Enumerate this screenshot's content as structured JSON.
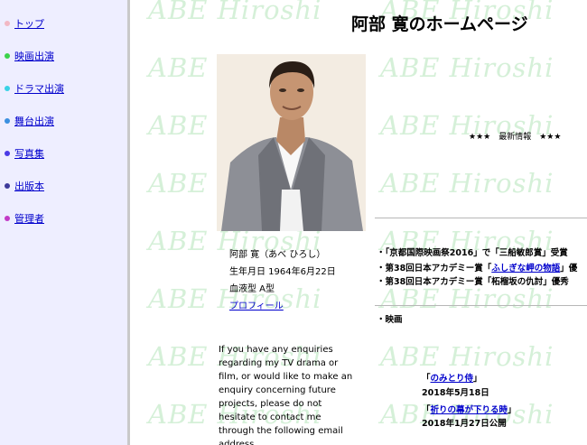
{
  "nav": {
    "items": [
      {
        "label": "トップ",
        "color": "#f2b8c4"
      },
      {
        "label": "映画出演",
        "color": "#3bd24a"
      },
      {
        "label": "ドラマ出演",
        "color": "#39d2e6"
      },
      {
        "label": "舞台出演",
        "color": "#3a8fe0"
      },
      {
        "label": "写真集",
        "color": "#4a3ae6"
      },
      {
        "label": "出版本",
        "color": "#3d3a9a"
      },
      {
        "label": "管理者",
        "color": "#c23ac6"
      }
    ]
  },
  "watermark_text": "ABE Hiroshi",
  "page_title": "阿部 寛のホームページ",
  "news_heading": "★★★　最新情報　★★★",
  "profile": {
    "name": "阿部 寛（あべ ひろし）",
    "birthday": "生年月日 1964年6月22日",
    "blood_type": "血液型 A型",
    "link": "プロフィール"
  },
  "contact_text": "If you have any enquiries regarding my TV drama or film, or would like to make an enquiry concerning future projects, please do not hesitate to contact me through the following email address.",
  "news": [
    {
      "pre": "・「京都国際映画祭2016」で「三船敏郎賞」受賞",
      "link": "",
      "post": ""
    },
    {
      "pre": "・第38回日本アカデミー賞「",
      "link": "ふしぎな岬の物語",
      "post": "」優"
    },
    {
      "pre": "・第38回日本アカデミー賞「柘榴坂の仇討」優秀",
      "link": "",
      "post": ""
    }
  ],
  "movies_label": "・映画",
  "movies": [
    {
      "title": "のみとり侍",
      "date": "2018年5月18日"
    },
    {
      "title": "祈りの幕が下りる時",
      "date": "2018年1月27日公開"
    }
  ]
}
